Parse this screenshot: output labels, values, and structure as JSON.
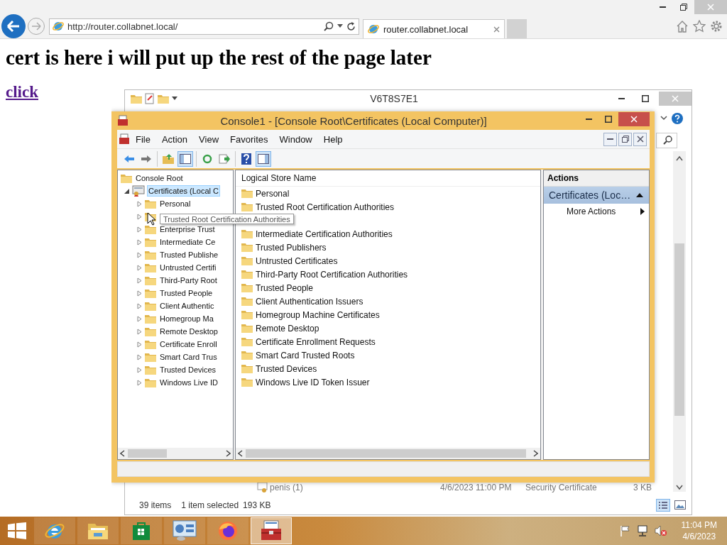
{
  "browser": {
    "address": "http://router.collabnet.local/",
    "tabs": [
      {
        "label": "router.collabnet.local",
        "selected": true
      }
    ]
  },
  "page": {
    "heading": "cert is here i will put up the rest of the page later",
    "link": "click"
  },
  "explorer": {
    "title": "V6T8S7E1",
    "file_row": {
      "name": "penis (1)",
      "date": "4/6/2023 11:00 PM",
      "type": "Security Certificate",
      "size": "3 KB"
    },
    "status": {
      "count": "39 items",
      "selection": "1 item selected",
      "size": "193 KB"
    }
  },
  "console": {
    "title": "Console1 - [Console Root\\Certificates (Local Computer)]",
    "menu": [
      "File",
      "Action",
      "View",
      "Favorites",
      "Window",
      "Help"
    ],
    "toolbar_groups": [
      {
        "buttons": [
          {
            "kind": "back",
            "selected": false
          },
          {
            "kind": "forward",
            "selected": false
          }
        ]
      },
      {
        "buttons": [
          {
            "kind": "up",
            "selected": false
          },
          {
            "kind": "tree",
            "selected": true
          }
        ]
      },
      {
        "buttons": [
          {
            "kind": "refresh",
            "selected": false
          },
          {
            "kind": "export",
            "selected": false
          }
        ]
      },
      {
        "buttons": [
          {
            "kind": "help",
            "selected": false
          },
          {
            "kind": "pane",
            "selected": true
          }
        ]
      }
    ],
    "tree": [
      {
        "label": "Console Root",
        "kind": "folder",
        "children": [
          {
            "label": "Certificates (Local C",
            "kind": "store",
            "expanded": true,
            "selected": true,
            "children": [
              {
                "label": "Personal",
                "kind": "folder",
                "expanded": false
              },
              {
                "kind": "folder",
                "expanded": false
              },
              {
                "label": "Enterprise Trust",
                "kind": "folder",
                "expanded": false
              },
              {
                "label": "Intermediate Ce",
                "kind": "folder",
                "expanded": false
              },
              {
                "label": "Trusted Publishe",
                "kind": "folder",
                "expanded": false
              },
              {
                "label": "Untrusted Certifi",
                "kind": "folder",
                "expanded": false
              },
              {
                "label": "Third-Party Root",
                "kind": "folder",
                "expanded": false
              },
              {
                "label": "Trusted People",
                "kind": "folder",
                "expanded": false
              },
              {
                "label": "Client Authentic",
                "kind": "folder",
                "expanded": false
              },
              {
                "label": "Homegroup Ma",
                "kind": "folder",
                "expanded": false
              },
              {
                "label": "Remote Desktop",
                "kind": "folder",
                "expanded": false
              },
              {
                "label": "Certificate Enroll",
                "kind": "folder",
                "expanded": false
              },
              {
                "label": "Smart Card Trus",
                "kind": "folder",
                "expanded": false
              },
              {
                "label": "Trusted Devices",
                "kind": "folder",
                "expanded": false
              },
              {
                "label": "Windows Live ID",
                "kind": "folder",
                "expanded": false
              }
            ]
          }
        ]
      }
    ],
    "list": {
      "column": "Logical Store Name",
      "rows": [
        {
          "label": "Personal"
        },
        {
          "label": "Trusted Root Certification Authorities"
        },
        {},
        {
          "label": "Intermediate Certification Authorities"
        },
        {
          "label": "Trusted Publishers"
        },
        {
          "label": "Untrusted Certificates"
        },
        {
          "label": "Third-Party Root Certification Authorities"
        },
        {
          "label": "Trusted People"
        },
        {
          "label": "Client Authentication Issuers"
        },
        {
          "label": "Homegroup Machine Certificates"
        },
        {
          "label": "Remote Desktop"
        },
        {
          "label": "Certificate Enrollment Requests"
        },
        {
          "label": "Smart Card Trusted Roots"
        },
        {
          "label": "Trusted Devices"
        },
        {
          "label": "Windows Live ID Token Issuer"
        }
      ]
    },
    "actions": {
      "title": "Actions",
      "group": "Certificates (Loc…",
      "items": [
        "More Actions"
      ]
    },
    "tooltip": "Trusted Root Certification Authorities"
  },
  "taskbar": {
    "apps": [
      {
        "kind": "ie",
        "selected": false
      },
      {
        "kind": "explorer",
        "selected": false
      },
      {
        "kind": "store",
        "selected": false
      },
      {
        "kind": "control",
        "selected": false
      },
      {
        "kind": "firefox",
        "selected": false
      },
      {
        "kind": "toolbox",
        "selected": true
      }
    ],
    "time": "11:04 PM",
    "date": "4/6/2023"
  }
}
